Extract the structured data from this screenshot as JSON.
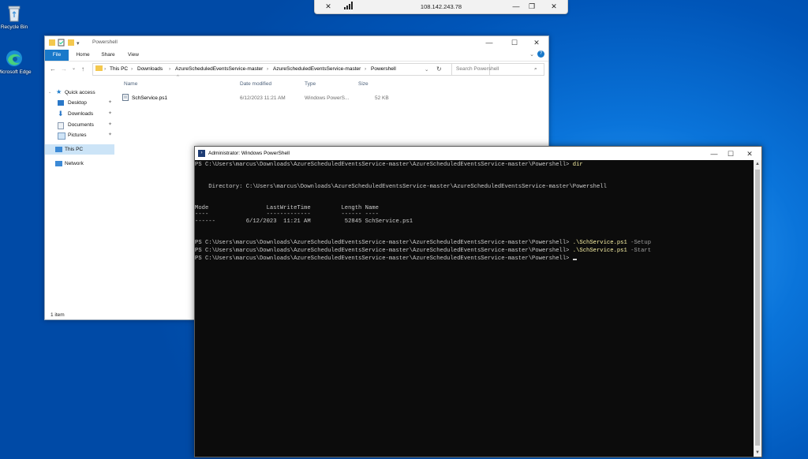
{
  "desktop": {
    "icons": [
      {
        "label": "Recycle Bin",
        "icon": "recycle-bin-icon"
      },
      {
        "label": "Microsoft Edge",
        "icon": "edge-icon"
      }
    ]
  },
  "remote_bar": {
    "title": "108.142.243.78",
    "icons": [
      "unpin-icon",
      "signal-icon",
      "minimize-icon",
      "restore-icon",
      "close-icon"
    ]
  },
  "explorer": {
    "title": "Powershell",
    "ribbon_tabs": [
      "File",
      "Home",
      "Share",
      "View"
    ],
    "breadcrumb": [
      "This PC",
      "Downloads",
      "AzureScheduledEventsService-master",
      "AzureScheduledEventsService-master",
      "Powershell"
    ],
    "search_placeholder": "Search Powershell",
    "nav": {
      "quick_access": "Quick access",
      "items": [
        "Desktop",
        "Downloads",
        "Documents",
        "Pictures"
      ],
      "this_pc": "This PC",
      "network": "Network"
    },
    "columns": [
      "Name",
      "Date modified",
      "Type",
      "Size"
    ],
    "files": [
      {
        "name": "SchService.ps1",
        "date": "6/12/2023 11:21 AM",
        "type": "Windows PowerS...",
        "size": "52 KB"
      }
    ],
    "status": "1 item"
  },
  "powershell": {
    "title": "Administrator: Windows PowerShell",
    "prompt": "PS C:\\Users\\marcus\\Downloads\\AzureScheduledEventsService-master\\AzureScheduledEventsService-master\\Powershell>",
    "cmd1": "dir",
    "directory_line": "    Directory: C:\\Users\\marcus\\Downloads\\AzureScheduledEventsService-master\\AzureScheduledEventsService-master\\Powershell",
    "header_line": "Mode                 LastWriteTime         Length Name",
    "dash_line": "----                 -------------         ------ ----",
    "row_line": "------         6/12/2023  11:21 AM          52845 SchService.ps1",
    "cmd2": ".\\SchService.ps1",
    "cmd2_arg": "-Setup",
    "cmd3": ".\\SchService.ps1",
    "cmd3_arg": "-Start"
  }
}
